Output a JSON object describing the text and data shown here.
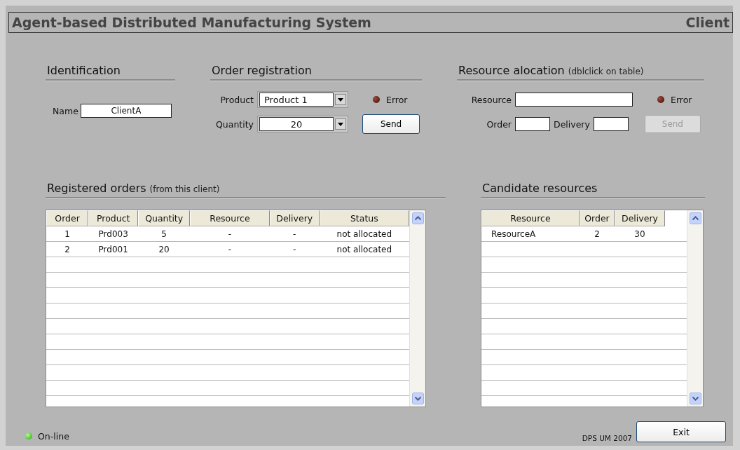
{
  "window": {
    "title": "Agent-based Distributed Manufacturing System",
    "role": "Client"
  },
  "identification": {
    "heading": "Identification",
    "name_label": "Name",
    "name_value": "ClientA"
  },
  "order_registration": {
    "heading": "Order registration",
    "product_label": "Product",
    "product_value": "Product 1",
    "quantity_label": "Quantity",
    "quantity_value": "20",
    "error": {
      "label": "Error",
      "lit": false
    },
    "send": {
      "label": "Send",
      "disabled": false
    }
  },
  "resource_allocation": {
    "heading": "Resource alocation",
    "hint": "(dblclick on table)",
    "resource_label": "Resource",
    "order_label": "Order",
    "delivery_label": "Delivery",
    "error": {
      "label": "Error",
      "lit": false
    },
    "send": {
      "label": "Send",
      "disabled": true
    }
  },
  "registered_orders": {
    "heading": "Registered orders",
    "hint": "(from this client)",
    "columns": [
      "Order",
      "Product",
      "Quantity",
      "Resource",
      "Delivery",
      "Status"
    ],
    "rows": [
      [
        "1",
        "Prd003",
        "5",
        "-",
        "-",
        "not allocated"
      ],
      [
        "2",
        "Prd001",
        "20",
        "-",
        "-",
        "not allocated"
      ]
    ]
  },
  "candidate_resources": {
    "heading": "Candidate resources",
    "columns": [
      "Resource",
      "Order",
      "Delivery"
    ],
    "rows": [
      [
        "ResourceA",
        "2",
        "30"
      ]
    ]
  },
  "status": {
    "label": "On-line",
    "lit": true
  },
  "credit": "DPS UM 2007",
  "exit": "Exit"
}
